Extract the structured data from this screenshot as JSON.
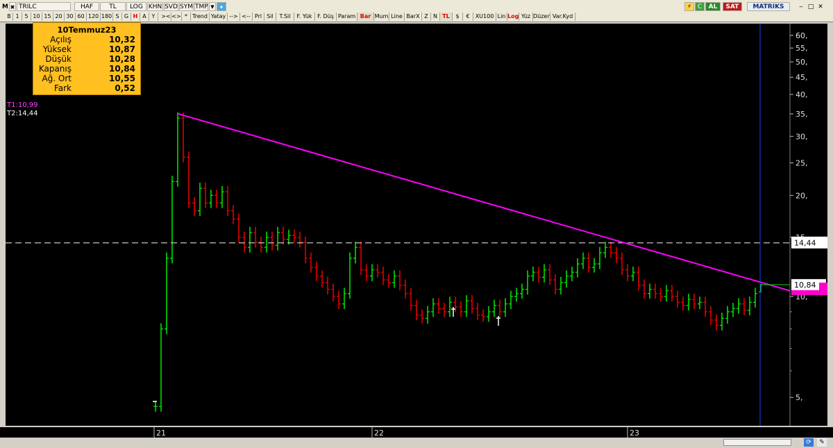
{
  "toolbar": {
    "menu_letter": "M",
    "symbol": "TRILC",
    "buttons": [
      "HAF",
      "TL",
      "LOG",
      "KHN",
      "SVD",
      "SYM",
      "TMP"
    ],
    "al_label": "AL",
    "sat_label": "SAT",
    "brand": "MATRIKS"
  },
  "periods": [
    "B",
    "1",
    "5",
    "10",
    "15",
    "20",
    "30",
    "60",
    "120",
    "180",
    "S",
    "G",
    "H",
    "A",
    "Y"
  ],
  "active_period": "H",
  "tools": [
    "><",
    "<>",
    "*",
    "Trend",
    "Yatay",
    "-->",
    "<--",
    "Prl",
    "Sil",
    "T.Sil",
    "F. Yük",
    "F. Düş",
    "Param",
    "Bar",
    "Mum",
    "Line",
    "BarX",
    "Z",
    "N",
    "TL",
    "$",
    "€",
    "XU100",
    "Lin",
    "Log",
    "Yüz",
    "Düzen",
    "Var.Kyd"
  ],
  "active_tools": [
    "Bar",
    "TL",
    "Log"
  ],
  "info_box": {
    "title": "10Temmuz23",
    "rows": [
      {
        "label": "Açılış",
        "value": "10,32"
      },
      {
        "label": "Yüksek",
        "value": "10,87"
      },
      {
        "label": "Düşük",
        "value": "10,28"
      },
      {
        "label": "Kapanış",
        "value": "10,84"
      },
      {
        "label": "Ağ. Ort",
        "value": "10,55"
      },
      {
        "label": "Fark",
        "value": "0,52"
      }
    ]
  },
  "trendline_labels": {
    "t1": "T1:10,99",
    "t2": "T2:14,44"
  },
  "price_tags": {
    "horizontal": "14,44",
    "last": "10,84"
  },
  "colors": {
    "background": "#000000",
    "up_bar": "#00e000",
    "down_bar": "#e00000",
    "trend_line": "#ff00ff",
    "horizontal_line": "#d8d8d8",
    "info_box": "#ffc020",
    "current_marker": "#1a3cff"
  },
  "chart_data": {
    "type": "bar",
    "scale": "log",
    "y_ticks": [
      "60,",
      "55,",
      "50,",
      "45,",
      "40,",
      "35,",
      "30,",
      "25,",
      "20,",
      "15,",
      "10,",
      "5,"
    ],
    "ylim": [
      4.4,
      62
    ],
    "x_labels": [
      "21",
      "22",
      "23"
    ],
    "last_bar": {
      "open": 10.32,
      "high": 10.87,
      "low": 10.28,
      "close": 10.84
    },
    "horizontal_line": 14.44,
    "trend_line": {
      "start": 35.0,
      "end": 10.4
    },
    "closes": [
      4.7,
      8.0,
      13.0,
      22.0,
      34.0,
      26.0,
      19.0,
      18.0,
      21.0,
      19.0,
      20.0,
      19.0,
      20.5,
      18.0,
      17.0,
      15.0,
      14.0,
      15.5,
      14.5,
      14.0,
      15.0,
      14.2,
      15.5,
      14.8,
      15.2,
      15.0,
      14.5,
      13.0,
      12.2,
      11.5,
      11.0,
      10.5,
      10.0,
      9.5,
      10.2,
      13.0,
      14.0,
      12.0,
      11.5,
      12.0,
      11.8,
      11.2,
      11.0,
      11.5,
      10.8,
      10.2,
      9.4,
      8.8,
      8.6,
      9.0,
      9.5,
      9.2,
      9.0,
      9.6,
      9.3,
      9.0,
      9.7,
      9.2,
      8.8,
      8.7,
      9.0,
      9.4,
      9.0,
      9.5,
      10.0,
      10.2,
      10.5,
      11.5,
      11.8,
      11.4,
      12.0,
      11.2,
      10.5,
      11.0,
      11.5,
      11.8,
      12.5,
      13.0,
      12.2,
      12.5,
      13.5,
      14.0,
      13.5,
      13.0,
      12.0,
      11.5,
      11.8,
      10.8,
      10.2,
      10.5,
      10.2,
      10.0,
      10.4,
      10.0,
      9.6,
      9.4,
      9.8,
      9.5,
      9.6,
      9.0,
      8.5,
      8.2,
      8.6,
      9.0,
      9.2,
      9.5,
      9.1,
      9.6,
      10.2,
      10.84
    ]
  },
  "bottom_icons": [
    "refresh-icon",
    "pin-icon"
  ]
}
